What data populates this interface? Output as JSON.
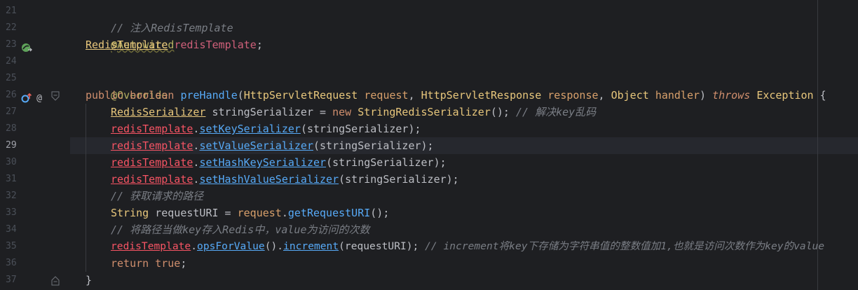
{
  "editor": {
    "line_numbers": [
      "21",
      "22",
      "23",
      "24",
      "25",
      "26",
      "27",
      "28",
      "29",
      "30",
      "31",
      "32",
      "33",
      "34",
      "35",
      "36",
      "37"
    ],
    "current_line": "29",
    "lines": {
      "l21": {
        "comment": "// 注入RedisTemplate"
      },
      "l22": {
        "annotation": "@Autowired"
      },
      "l23": {
        "type": "RedisTemplate",
        "name": "redisTemplate",
        "semi": ";"
      },
      "l25": {
        "annotation": "@Override"
      },
      "l26": {
        "kw1": "public",
        "kw2": "boolean",
        "method": "preHandle",
        "p1": "(",
        "t1": "HttpServletRequest",
        "n1": "request",
        "c1": ", ",
        "t2": "HttpServletResponse",
        "n2": "response",
        "c2": ", ",
        "t3": "Object",
        "n3": "handler",
        "p2": ") ",
        "kw3": "throws",
        "t4": "Exception",
        "brace": " {"
      },
      "l27": {
        "type": "RedisSerializer",
        "rest": " stringSerializer = ",
        "kw": "new",
        "cls": "StringRedisSerializer",
        "tail": "(); ",
        "comment": "// 解决key乱码"
      },
      "l28": {
        "field": "redisTemplate",
        "dot": ".",
        "method": "setKeySerializer",
        "args": "(stringSerializer);"
      },
      "l29": {
        "field": "redisTemplate",
        "dot": ".",
        "method": "setValueSerializer",
        "args": "(stringSerializer);"
      },
      "l30": {
        "field": "redisTemplate",
        "dot": ".",
        "method": "setHashKeySerializer",
        "args": "(stringSerializer);"
      },
      "l31": {
        "field": "redisTemplate",
        "dot": ".",
        "method": "setHashValueSerializer",
        "args": "(stringSerializer);"
      },
      "l32": {
        "comment": "// 获取请求的路径"
      },
      "l33": {
        "type": "String",
        "rest": " requestURI = ",
        "var": "request",
        "dot": ".",
        "method": "getRequestURI",
        "tail": "();"
      },
      "l34": {
        "comment": "// 将路径当做key存入Redis中，value为访问的次数"
      },
      "l35": {
        "field": "redisTemplate",
        "dot": ".",
        "m1": "opsForValue",
        "mid": "().",
        "m2": "increment",
        "args": "(requestURI); ",
        "comment": "// increment将key下存储为字符串值的整数值加1,也就是访问次数作为key的value"
      },
      "l36": {
        "kw1": "return",
        "kw2": "true",
        "semi": ";"
      },
      "l37": {
        "brace": "}"
      }
    },
    "gutter_icons": {
      "l23": "bean-injection-icon",
      "l26_a": "override-method-icon",
      "l26_b": "annotation-at-icon"
    }
  }
}
